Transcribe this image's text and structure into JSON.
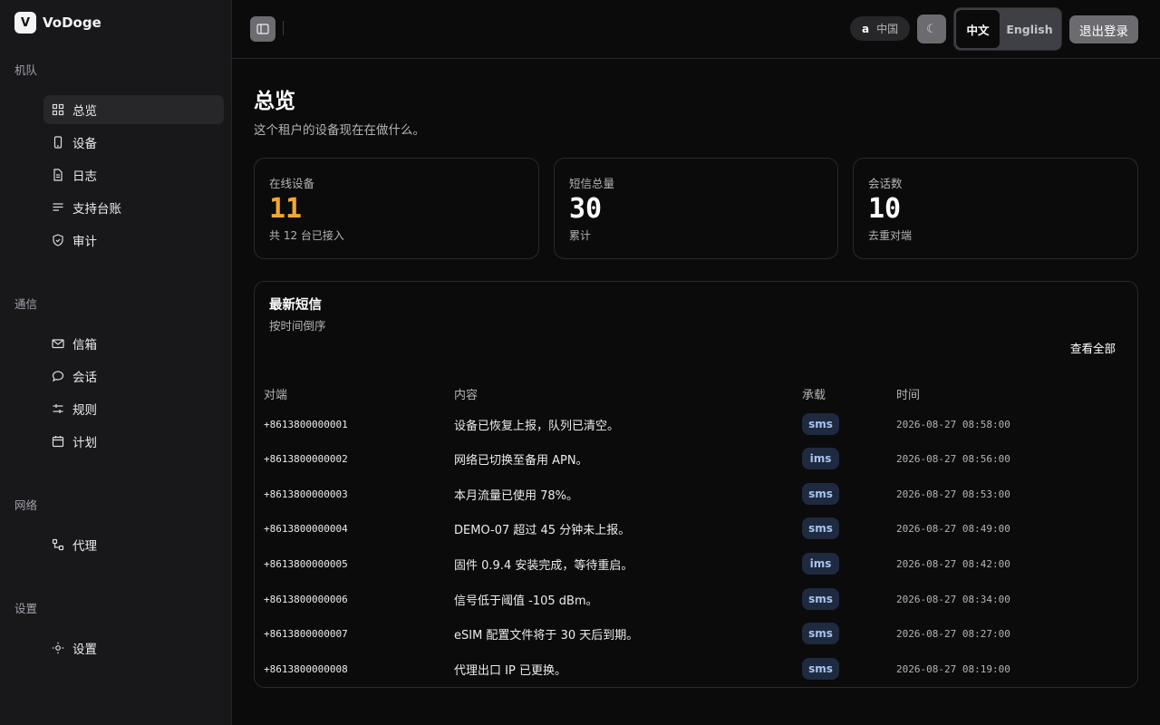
{
  "brand": {
    "logo_letter": "V",
    "name": "VoDoge"
  },
  "sidebar": {
    "groups": [
      {
        "label": "机队",
        "items": [
          {
            "label": "总览",
            "icon": "grid-icon",
            "active": true
          },
          {
            "label": "设备",
            "icon": "phone-icon"
          },
          {
            "label": "日志",
            "icon": "file-icon"
          },
          {
            "label": "支持台账",
            "icon": "list-icon"
          },
          {
            "label": "审计",
            "icon": "shield-icon"
          }
        ]
      },
      {
        "label": "通信",
        "items": [
          {
            "label": "信箱",
            "icon": "mail-icon"
          },
          {
            "label": "会话",
            "icon": "chat-icon"
          },
          {
            "label": "规则",
            "icon": "sliders-icon"
          },
          {
            "label": "计划",
            "icon": "calendar-icon"
          }
        ]
      },
      {
        "label": "网络",
        "items": [
          {
            "label": "代理",
            "icon": "network-icon"
          }
        ]
      },
      {
        "label": "设置",
        "items": [
          {
            "label": "设置",
            "icon": "gear-icon"
          }
        ]
      }
    ]
  },
  "topbar": {
    "tenant_avatar": "a",
    "tenant_name": "中国",
    "theme_icon": "☾",
    "lang_zh": "中文",
    "lang_en": "English",
    "logout_label": "退出登录"
  },
  "page": {
    "title": "总览",
    "subtitle": "这个租户的设备现在在做什么。"
  },
  "stats": [
    {
      "label": "在线设备",
      "value": "11",
      "hint": "共 12 台已接入",
      "accent": "#f0a830"
    },
    {
      "label": "短信总量",
      "value": "30",
      "hint": "累计"
    },
    {
      "label": "会话数",
      "value": "10",
      "hint": "去重对端"
    }
  ],
  "sms": {
    "title": "最新短信",
    "subtitle": "按时间倒序",
    "view_all": "查看全部",
    "columns": [
      "对端",
      "内容",
      "承载",
      "时间"
    ],
    "rows": [
      {
        "peer": "+8613800000001",
        "content": "设备已恢复上报，队列已清空。",
        "bearer": "sms",
        "time": "2026-08-27 08:58:00"
      },
      {
        "peer": "+8613800000002",
        "content": "网络已切换至备用 APN。",
        "bearer": "ims",
        "time": "2026-08-27 08:56:00"
      },
      {
        "peer": "+8613800000003",
        "content": "本月流量已使用 78%。",
        "bearer": "sms",
        "time": "2026-08-27 08:53:00"
      },
      {
        "peer": "+8613800000004",
        "content": "DEMO-07 超过 45 分钟未上报。",
        "bearer": "sms",
        "time": "2026-08-27 08:49:00"
      },
      {
        "peer": "+8613800000005",
        "content": "固件 0.9.4 安装完成，等待重启。",
        "bearer": "ims",
        "time": "2026-08-27 08:42:00"
      },
      {
        "peer": "+8613800000006",
        "content": "信号低于阈值 -105 dBm。",
        "bearer": "sms",
        "time": "2026-08-27 08:34:00"
      },
      {
        "peer": "+8613800000007",
        "content": "eSIM 配置文件将于 30 天后到期。",
        "bearer": "sms",
        "time": "2026-08-27 08:27:00"
      },
      {
        "peer": "+8613800000008",
        "content": "代理出口 IP 已更换。",
        "bearer": "sms",
        "time": "2026-08-27 08:19:00"
      }
    ]
  }
}
